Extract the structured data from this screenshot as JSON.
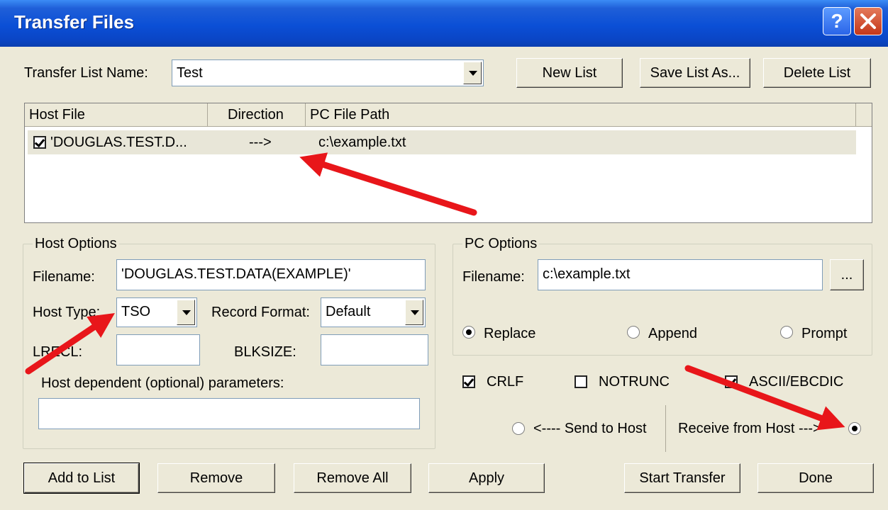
{
  "window": {
    "title": "Transfer Files"
  },
  "transfer_list": {
    "label": "Transfer List Name:",
    "value": "Test",
    "new_list": "New List",
    "save_list_as": "Save List As...",
    "delete_list": "Delete List"
  },
  "list_view": {
    "columns": [
      "Host File",
      "Direction",
      "PC File Path"
    ],
    "rows": [
      {
        "host_file": "'DOUGLAS.TEST.D...",
        "direction": "--->",
        "pc_path": "c:\\example.txt",
        "checked": true
      }
    ]
  },
  "host_options": {
    "title": "Host Options",
    "filename_label": "Filename:",
    "filename_value": "'DOUGLAS.TEST.DATA(EXAMPLE)'",
    "host_type_label": "Host Type:",
    "host_type_value": "TSO",
    "record_format_label": "Record Format:",
    "record_format_value": "Default",
    "lrecl_label": "LRECL:",
    "lrecl_value": "",
    "blksize_label": "BLKSIZE:",
    "blksize_value": "",
    "params_label": "Host dependent (optional) parameters:",
    "params_value": ""
  },
  "pc_options": {
    "title": "PC Options",
    "filename_label": "Filename:",
    "filename_value": "c:\\example.txt",
    "browse_label": "...",
    "replace_label": "Replace",
    "append_label": "Append",
    "prompt_label": "Prompt",
    "selected_mode": "Replace"
  },
  "options": {
    "crlf_label": "CRLF",
    "crlf_checked": true,
    "notrunc_label": "NOTRUNC",
    "notrunc_checked": false,
    "ascii_label": "ASCII/EBCDIC",
    "ascii_checked": true,
    "send_label": "<---- Send to Host",
    "receive_label": "Receive from Host --->",
    "direction_selected": "receive"
  },
  "buttons": {
    "add_to_list": "Add to List",
    "remove": "Remove",
    "remove_all": "Remove All",
    "apply": "Apply",
    "start_transfer": "Start Transfer",
    "done": "Done"
  },
  "colors": {
    "titlebar": "#0b4fd6",
    "dialog_bg": "#ece9d8",
    "annotation_arrow": "#e8161a"
  }
}
